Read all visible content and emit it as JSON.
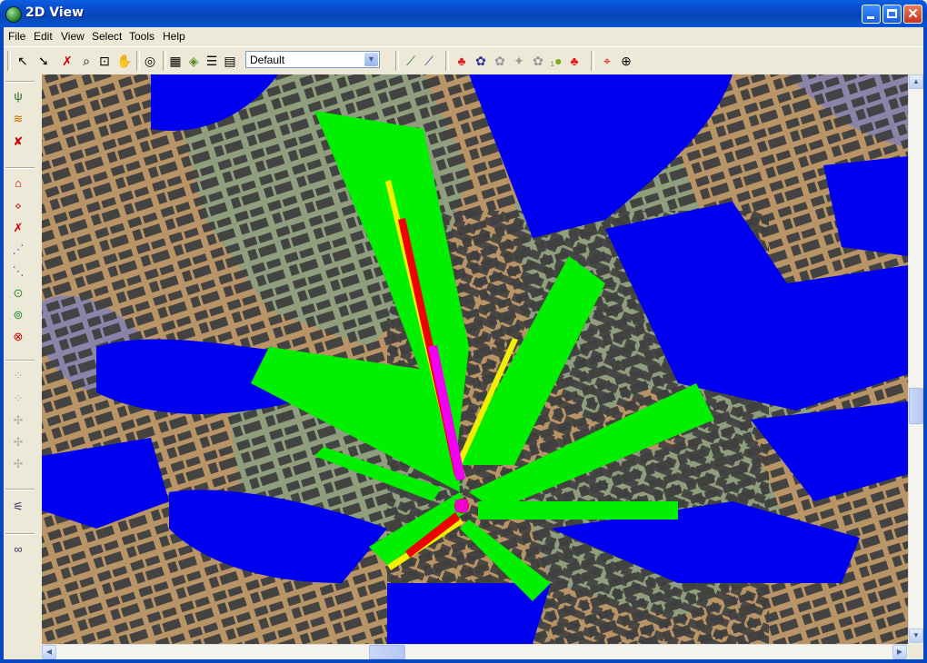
{
  "window": {
    "title": "2D View",
    "minimize_icon": "minimize-icon",
    "maximize_icon": "maximize-icon",
    "close_icon": "close-icon"
  },
  "menu": [
    "File",
    "Edit",
    "View",
    "Select",
    "Tools",
    "Help"
  ],
  "toolbar": {
    "view_combo_value": "Default"
  },
  "map": {
    "colors": {
      "background_terrain": "#B89466",
      "open_area": "#8F9E7C",
      "buildings": "#3F3F3F",
      "coverage_weak": "#0000F0",
      "coverage_medium": "#00F000",
      "coverage_good": "#F0F000",
      "coverage_strong": "#F00000",
      "coverage_best": "#F000F0",
      "water_area": "#8C84A8"
    }
  }
}
